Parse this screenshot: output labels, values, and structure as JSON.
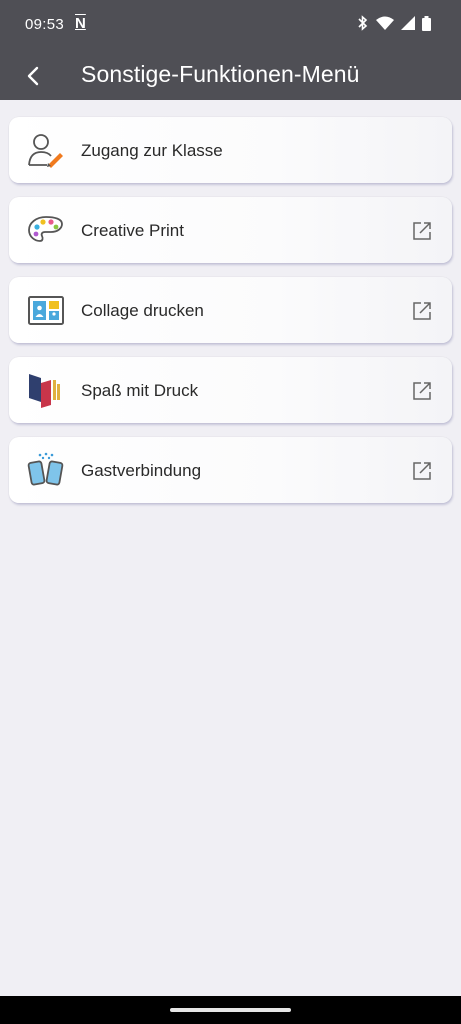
{
  "status": {
    "time": "09:53",
    "notification_icon": "N"
  },
  "appbar": {
    "title": "Sonstige-Funktionen-Menü",
    "back_icon": "chevron-left-icon"
  },
  "menu": [
    {
      "label": "Zugang zur Klasse",
      "icon": "user-edit-icon",
      "external": false
    },
    {
      "label": "Creative Print",
      "icon": "palette-icon",
      "external": true
    },
    {
      "label": "Collage drucken",
      "icon": "collage-icon",
      "external": true
    },
    {
      "label": "Spaß mit Druck",
      "icon": "fun-print-icon",
      "external": true
    },
    {
      "label": "Gastverbindung",
      "icon": "guest-connection-icon",
      "external": true
    }
  ],
  "colors": {
    "header": "#4f4f55",
    "background": "#f0eff4",
    "accent_orange": "#f07a1e"
  }
}
